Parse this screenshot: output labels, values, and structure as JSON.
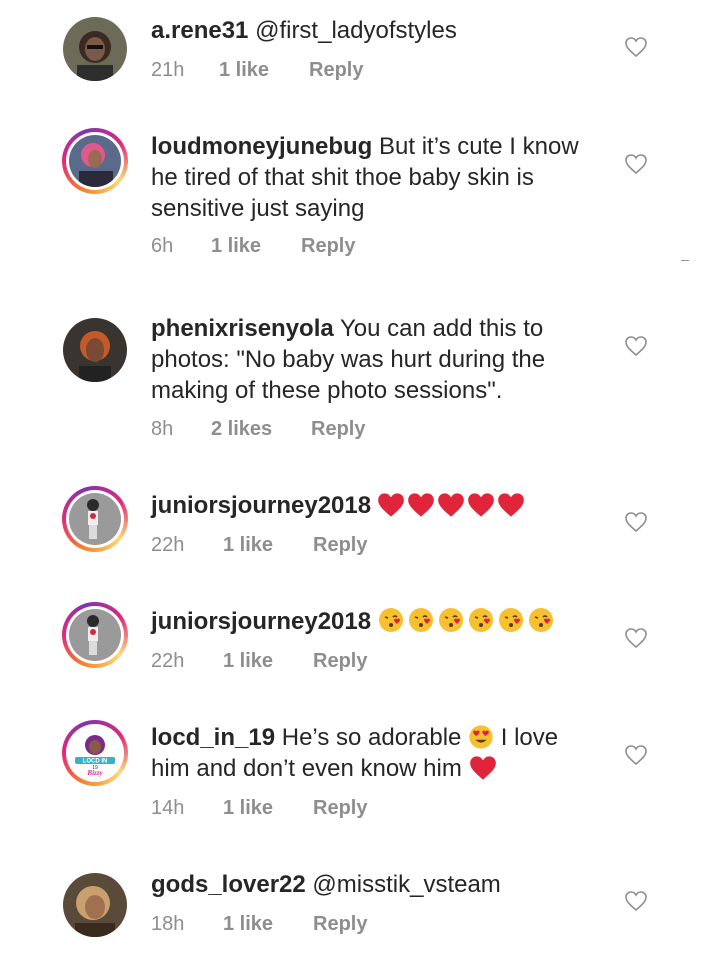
{
  "comments": [
    {
      "username": "a.rene31",
      "text": "@first_ladyofstyles",
      "time": "21h",
      "likes": "1 like",
      "reply": "Reply"
    },
    {
      "username": "loudmoneyjunebug",
      "text": "But it’s cute I know he tired of that shit thoe baby skin is sensitive just saying",
      "time": "6h",
      "likes": "1 like",
      "reply": "Reply"
    },
    {
      "username": "phenixrisenyola",
      "text": "You can add this to photos: \"No baby was hurt during the making of these photo sessions\".",
      "time": "8h",
      "likes": "2 likes",
      "reply": "Reply"
    },
    {
      "username": "juniorsjourney2018",
      "text": "",
      "emoji": "red-heart",
      "emoji_count": 5,
      "time": "22h",
      "likes": "1 like",
      "reply": "Reply"
    },
    {
      "username": "juniorsjourney2018",
      "text": "",
      "emoji": "face-blowing-kiss",
      "emoji_count": 6,
      "time": "22h",
      "likes": "1 like",
      "reply": "Reply"
    },
    {
      "username": "locd_in_19",
      "text_a": "He’s so adorable",
      "text_b": "I love",
      "text_c": "him and don’t even know him",
      "time": "14h",
      "likes": "1 like",
      "reply": "Reply"
    },
    {
      "username": "gods_lover22",
      "text": "@misstik_vsteam",
      "time": "18h",
      "likes": "1 like",
      "reply": "Reply"
    }
  ],
  "avatar_badge": {
    "line1": "LOCD IN",
    "line2": "19",
    "line3": "Bizzy"
  },
  "colors": {
    "text": "#262626",
    "meta": "#8e8e8e",
    "heart_red": "#e0243a",
    "story_ring": "#dd2a7b"
  }
}
